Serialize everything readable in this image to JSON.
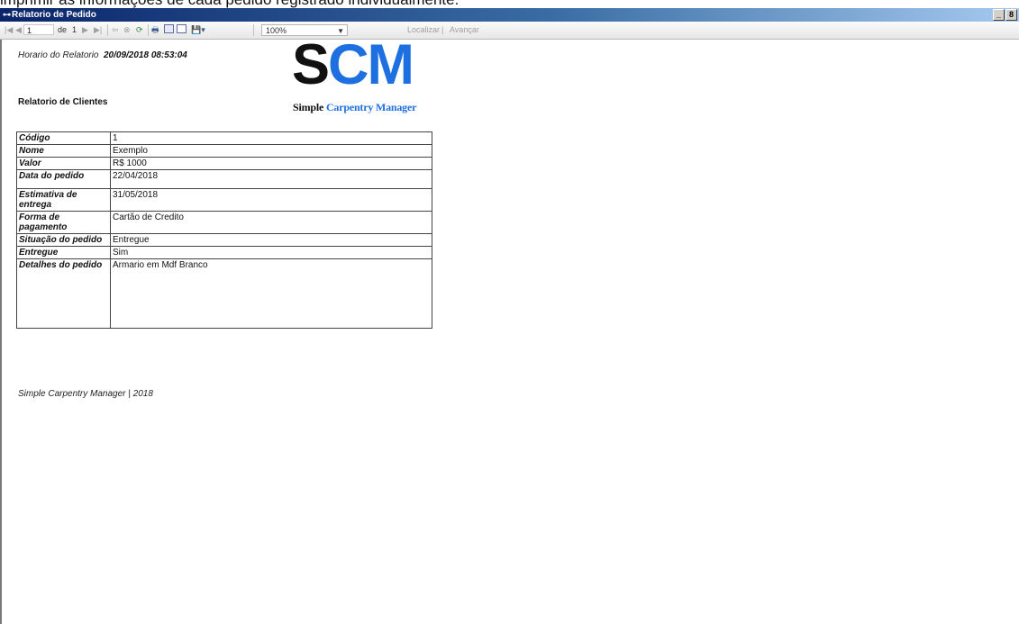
{
  "caption": "imprimir as informações de cada pedido registrado individualmente.",
  "window": {
    "title": "Relatorio de Pedido",
    "minimize": "_",
    "restore": "8"
  },
  "toolbar": {
    "page_current": "1",
    "page_of_label": "de",
    "page_total": "1",
    "zoom": "100%",
    "find_label": "Localizar",
    "find_sep": "|",
    "next_label": "Avançar"
  },
  "report": {
    "time_label": "Horario do Relatorio",
    "time_value": "20/09/2018 08:53:04",
    "heading": "Relatorio de Clientes",
    "logo": {
      "s": "S",
      "cm": "CM",
      "sub_a": "Simple",
      "sub_b": "Carpentry Manager"
    },
    "rows": [
      {
        "label": "Código",
        "value": "1"
      },
      {
        "label": "Nome",
        "value": "Exemplo"
      },
      {
        "label": "Valor",
        "value": "R$ 1000"
      },
      {
        "label": "Data do pedido",
        "value": "22/04/2018"
      },
      {
        "label": "Estimativa de entrega",
        "value": "31/05/2018"
      },
      {
        "label": "Forma de pagamento",
        "value": "Cartão de Credito"
      },
      {
        "label": "Situação do pedido",
        "value": "Entregue"
      },
      {
        "label": "Entregue",
        "value": "Sim"
      },
      {
        "label": "Detalhes do pedido",
        "value": "Armario em Mdf Branco"
      }
    ],
    "footer": "Simple Carpentry Manager | 2018"
  },
  "colors": {
    "logo_blue": "#1e6fe0",
    "titlebar_start": "#0a246a"
  }
}
